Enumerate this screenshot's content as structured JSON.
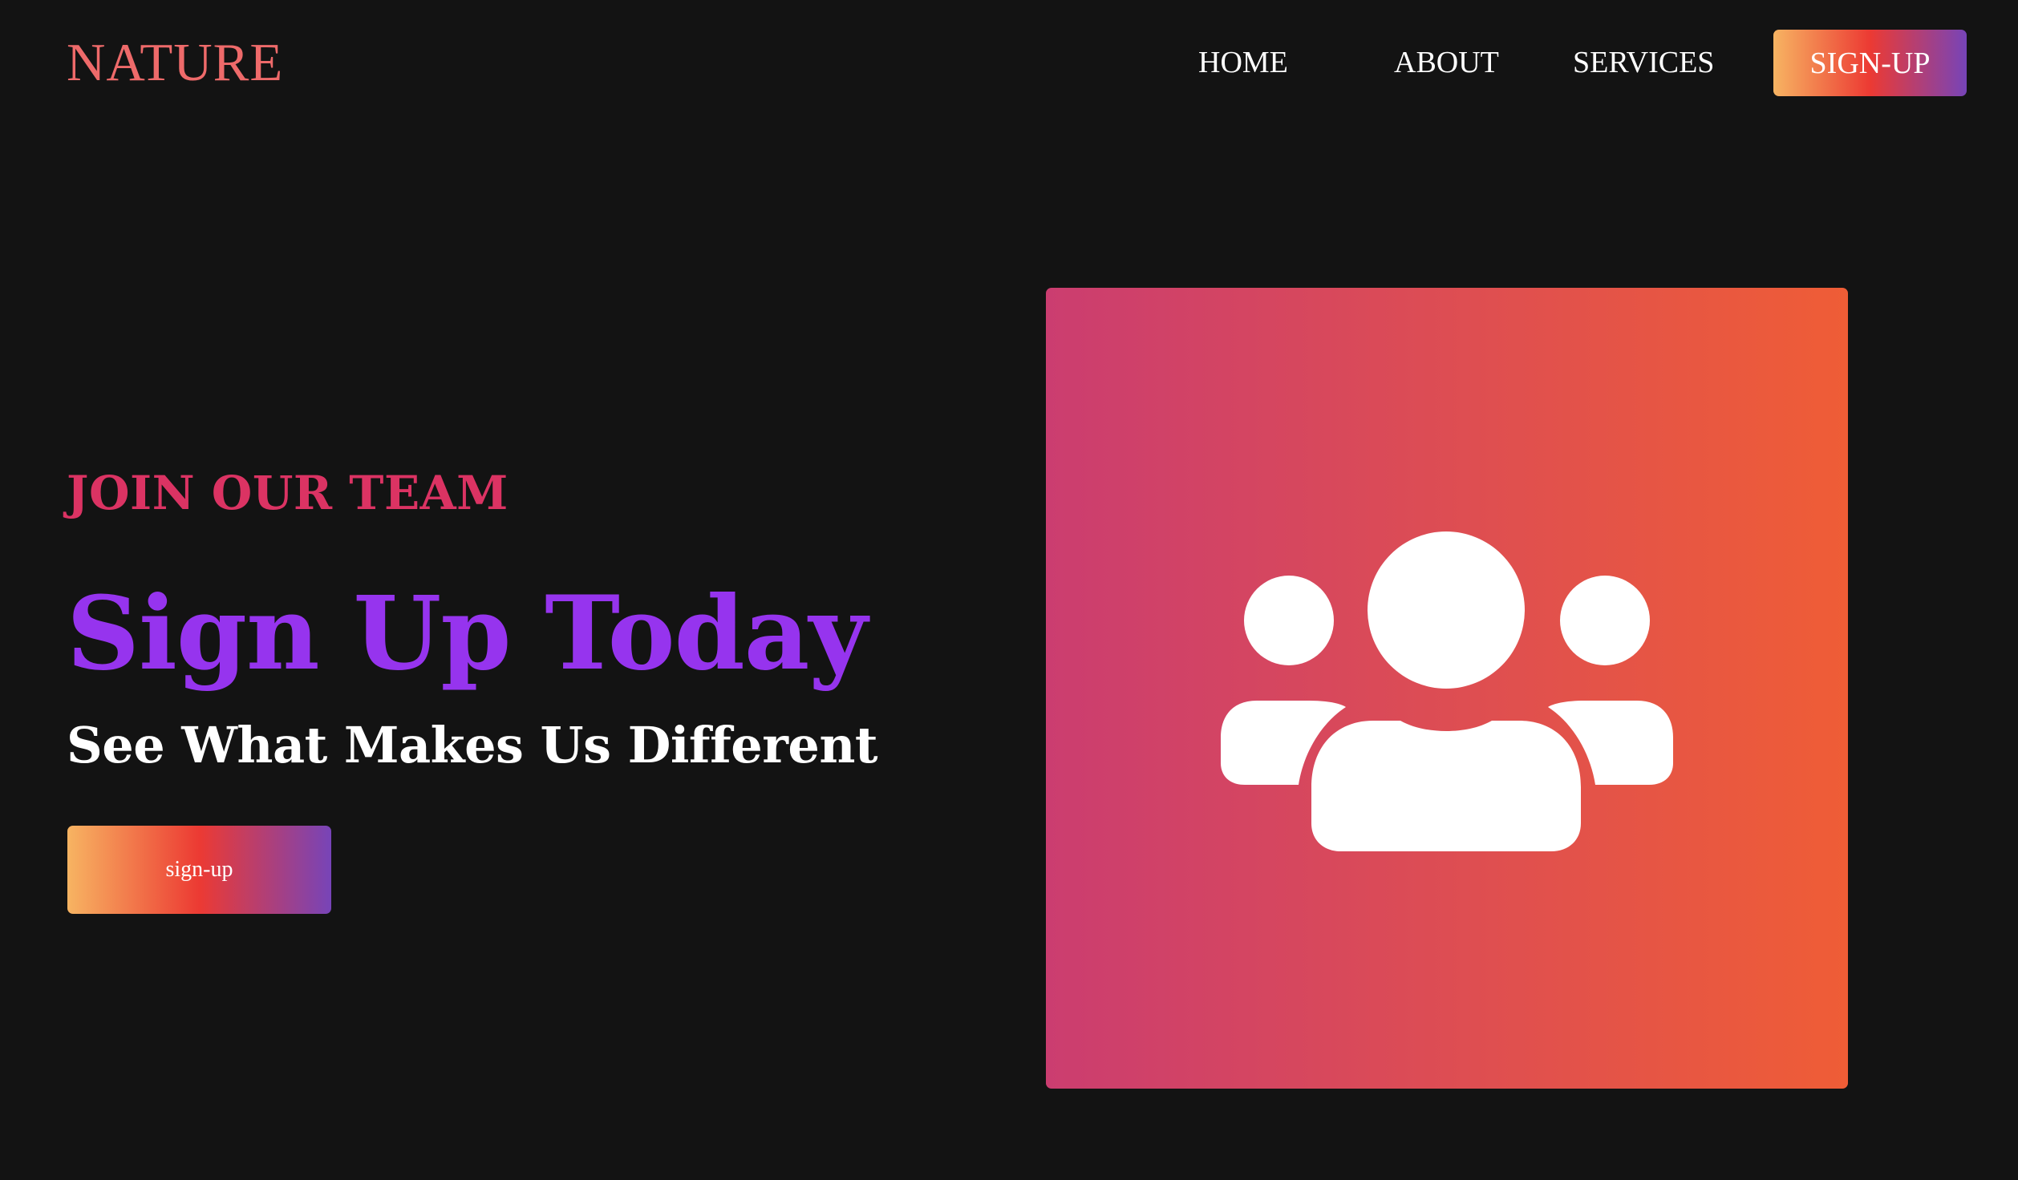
{
  "navbar": {
    "logo": "NATURE",
    "links": {
      "home": "HOME",
      "about": "ABOUT",
      "services": "SERVICES"
    },
    "signup_label": "SIGN-UP"
  },
  "hero": {
    "eyebrow": "JOIN OUR TEAM",
    "headline": "Sign Up Today",
    "subhead": "See What Makes Us Different",
    "cta_label": "sign-up"
  },
  "illustration": {
    "icon": "users-group-icon"
  },
  "colors": {
    "background": "#131313",
    "logo": "#ee6a6a",
    "eyebrow": "#db3363",
    "headline": "#9634ee",
    "text": "#ffffff",
    "button_gradient": [
      "#f7b462",
      "#ec3a33",
      "#7744b8"
    ],
    "card_gradient": [
      "#cb3d70",
      "#ef5d36"
    ]
  }
}
